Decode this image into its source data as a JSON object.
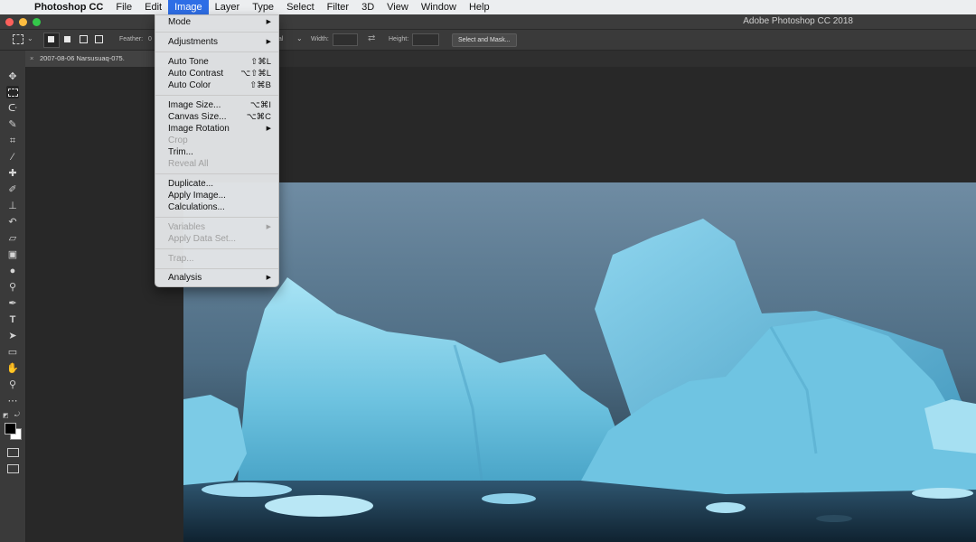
{
  "menubar": {
    "items": [
      "Photoshop CC",
      "File",
      "Edit",
      "Image",
      "Layer",
      "Type",
      "Select",
      "Filter",
      "3D",
      "View",
      "Window",
      "Help"
    ],
    "active": "Image"
  },
  "window": {
    "title": "Adobe Photoshop CC 2018"
  },
  "options": {
    "feather_label": "Feather:",
    "feather_value": "0",
    "style_value": "al",
    "width_label": "Width:",
    "height_label": "Height:",
    "select_mask": "Select and Mask..."
  },
  "document": {
    "tab_title": "2007-08-06 Narsusuaq-075.",
    "close_glyph": "×"
  },
  "image_menu": {
    "mode": "Mode",
    "adjustments": "Adjustments",
    "auto_tone": "Auto Tone",
    "auto_tone_key": "⇧⌘L",
    "auto_contrast": "Auto Contrast",
    "auto_contrast_key": "⌥⇧⌘L",
    "auto_color": "Auto Color",
    "auto_color_key": "⇧⌘B",
    "image_size": "Image Size...",
    "image_size_key": "⌥⌘I",
    "canvas_size": "Canvas Size...",
    "canvas_size_key": "⌥⌘C",
    "image_rotation": "Image Rotation",
    "crop": "Crop",
    "trim": "Trim...",
    "reveal_all": "Reveal All",
    "duplicate": "Duplicate...",
    "apply_image": "Apply Image...",
    "calculations": "Calculations...",
    "variables": "Variables",
    "apply_data_set": "Apply Data Set...",
    "trap": "Trap...",
    "analysis": "Analysis"
  },
  "colors": {
    "accent": "#2e6ee6",
    "ice": "#7fd0ea",
    "sky": "#5b7f99"
  }
}
